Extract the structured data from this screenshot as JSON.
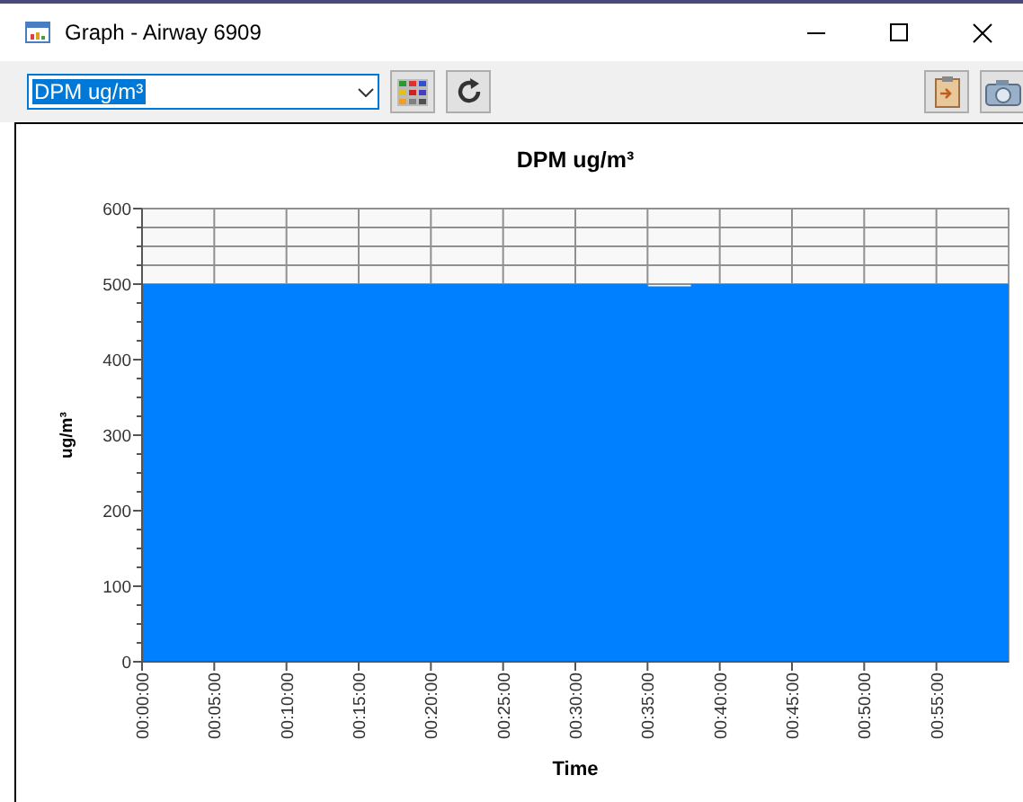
{
  "window": {
    "title": "Graph - Airway 6909"
  },
  "toolbar": {
    "series_select": {
      "value": "DPM ug/m³"
    }
  },
  "chart": {
    "chart_data": {
      "type": "area",
      "title": "DPM ug/m³",
      "xlabel": "Time",
      "ylabel": "ug/m³",
      "x": [
        0,
        35,
        35,
        38,
        38,
        60
      ],
      "series": [
        {
          "color": "#0080ff",
          "values": [
            500,
            500,
            497,
            497,
            500,
            500
          ]
        }
      ],
      "grid": true,
      "xlim": [
        0,
        60
      ],
      "ylim": [
        0,
        600
      ],
      "xticks": [
        {
          "value": 0,
          "label": "00:00:00"
        },
        {
          "value": 5,
          "label": "00:05:00"
        },
        {
          "value": 10,
          "label": "00:10:00"
        },
        {
          "value": 15,
          "label": "00:15:00"
        },
        {
          "value": 20,
          "label": "00:20:00"
        },
        {
          "value": 25,
          "label": "00:25:00"
        },
        {
          "value": 30,
          "label": "00:30:00"
        },
        {
          "value": 35,
          "label": "00:35:00"
        },
        {
          "value": 40,
          "label": "00:40:00"
        },
        {
          "value": 45,
          "label": "00:45:00"
        },
        {
          "value": 50,
          "label": "00:50:00"
        },
        {
          "value": 55,
          "label": "00:55:00"
        }
      ],
      "yticks": [
        0,
        100,
        200,
        300,
        400,
        500,
        600
      ]
    }
  }
}
